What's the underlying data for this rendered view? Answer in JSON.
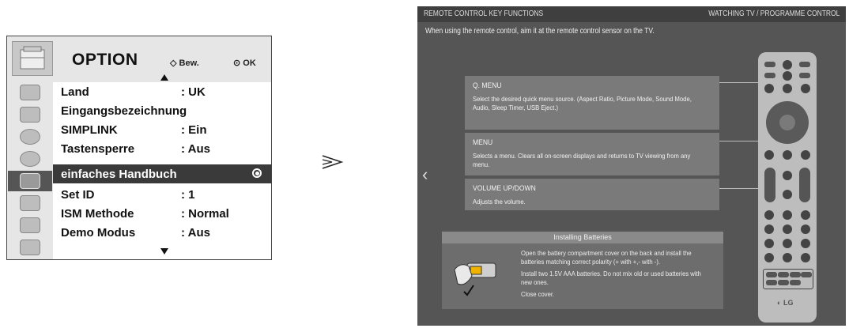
{
  "option_menu": {
    "title": "OPTION",
    "nav_hint": "Bew.",
    "ok_hint": "OK",
    "rows": [
      {
        "label": "Land",
        "value": ": UK"
      },
      {
        "label": "Eingangsbezeichnung",
        "value": ""
      },
      {
        "label": "SIMPLINK",
        "value": ": Ein"
      },
      {
        "label": "Tastensperre",
        "value": ": Aus"
      },
      {
        "label": "einfaches Handbuch",
        "value": ""
      },
      {
        "label": "Set ID",
        "value": ": 1"
      },
      {
        "label": "ISM Methode",
        "value": ": Normal"
      },
      {
        "label": "Demo Modus",
        "value": ": Aus"
      }
    ],
    "selected_row": "einfaches Handbuch",
    "sidebar_icons": [
      "picture-icon",
      "display-icon",
      "audio-icon",
      "time-icon",
      "option-icon",
      "lock-icon",
      "input-icon",
      "usb-icon"
    ]
  },
  "remote_screen": {
    "header_left": "REMOTE CONTROL KEY FUNCTIONS",
    "header_right": "WATCHING TV / PROGRAMME CONTROL",
    "intro": "When using the remote control, aim it at the remote control sensor on the TV.",
    "boxes": [
      {
        "title": "Q. MENU",
        "desc": "Select the desired quick menu source. (Aspect Ratio, Picture Mode, Sound Mode, Audio, Sleep Timer, USB Eject.)"
      },
      {
        "title": "MENU",
        "desc": "Selects a menu. Clears all on-screen displays and returns to TV viewing from any menu."
      },
      {
        "title": "VOLUME UP/DOWN",
        "desc": "Adjusts the volume."
      }
    ],
    "battery": {
      "title": "Installing Batteries",
      "steps": [
        "Open the battery compartment cover on the back and install the batteries matching correct polarity (+ with +,- with -).",
        "Install two 1.5V AAA batteries. Do not mix old or used batteries with new ones.",
        "Close cover."
      ]
    },
    "remote_brand": "LG"
  }
}
